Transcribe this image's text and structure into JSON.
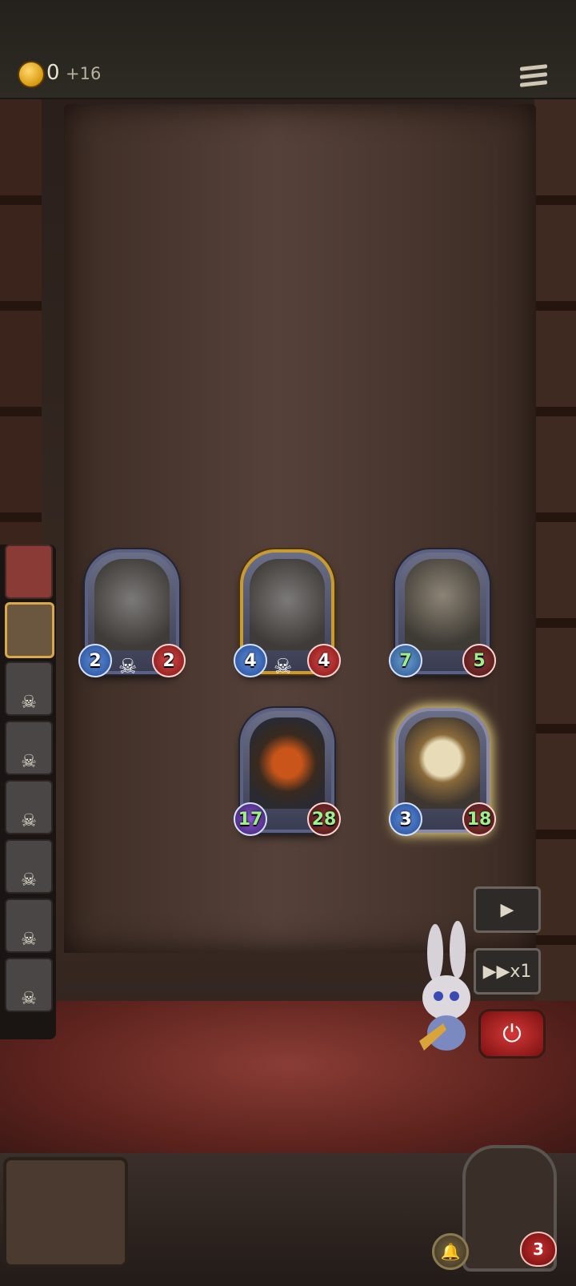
{
  "header": {
    "gold": "0",
    "gold_income": "+16"
  },
  "board": {
    "top_row": [
      {
        "atk": "2",
        "hp": "2",
        "name": "bell-robot-card"
      },
      {
        "atk": "4",
        "hp": "4",
        "name": "golden-bell-robot-card"
      },
      {
        "atk": "7",
        "hp": "5",
        "name": "airship-card"
      }
    ],
    "bottom_row": [
      {
        "atk": "17",
        "hp": "28",
        "name": "axe-weapon-card"
      },
      {
        "atk": "3",
        "hp": "18",
        "name": "clock-card"
      }
    ]
  },
  "controls": {
    "play": "▶",
    "speed": "▶▶x1",
    "power": "⏻"
  },
  "player": {
    "lives": "3"
  },
  "opponents_panel": {
    "slots": 8
  },
  "icons": [
    "coin-icon",
    "menu-icon",
    "skull-icon",
    "play-icon",
    "fast-forward-icon",
    "power-icon",
    "bell-icon",
    "heart-icon"
  ],
  "colors": {
    "gold": "#d99a12",
    "attack": "#3b6bc4",
    "health": "#b32525",
    "buffed": "#9ef08a"
  }
}
